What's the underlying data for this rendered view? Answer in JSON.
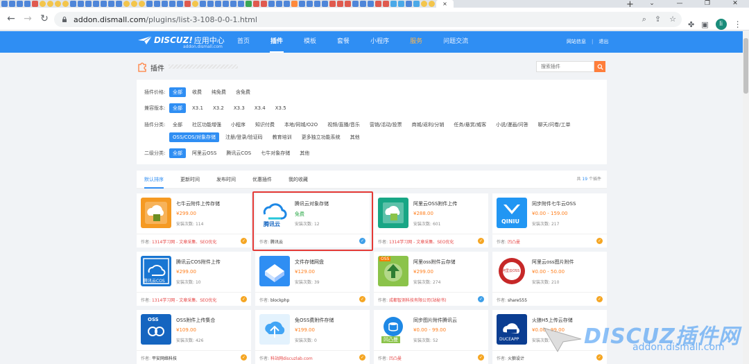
{
  "browser": {
    "url_host": "addon.dismall.com",
    "url_path": "/plugins/list-3-108-0-0-1.html",
    "avatar_letter": "li",
    "new_tab_symbol": "+",
    "close_tab_symbol": "×"
  },
  "header": {
    "brand": "DISCUZ!",
    "brand_cn": "应用中心",
    "sub": "addon.dismall.com",
    "nav": [
      "首页",
      "插件",
      "模板",
      "套餐",
      "小程序",
      "服务",
      "问题交流"
    ],
    "active_nav": "插件",
    "hot_nav": "服务",
    "user_links": [
      "网站信息",
      "退出"
    ]
  },
  "page": {
    "title": "插件",
    "search_placeholder": "搜索插件"
  },
  "filters": {
    "price": {
      "label": "插件价格:",
      "options": [
        "全部",
        "收费",
        "纯免费",
        "含免费"
      ],
      "selected": "全部"
    },
    "version": {
      "label": "兼容版本:",
      "options": [
        "全部",
        "X3.1",
        "X3.2",
        "X3.3",
        "X3.4",
        "X3.5"
      ],
      "selected": "全部"
    },
    "category": {
      "label": "插件分类:",
      "options_row1": [
        "全部",
        "社区功能增强",
        "小程序",
        "知识付费",
        "本地/同城/O2O",
        "视频/直播/音乐",
        "营销/活动/投票",
        "商城/返利/分销",
        "任务/悬赏/威客",
        "小说/漫画/问答",
        "聊天/问卷/工单"
      ],
      "options_row2": [
        "OSS/COS/对象存储",
        "注册/登录/验证码",
        "教育培训",
        "更多独立功能系统",
        "其他"
      ],
      "selected": "OSS/COS/对象存储"
    },
    "sub_category": {
      "label": "二级分类:",
      "options": [
        "全部",
        "阿里云OSS",
        "腾讯云COS",
        "七牛对象存储",
        "其他"
      ],
      "selected": "全部"
    }
  },
  "sort": {
    "tabs": [
      "默认排序",
      "更新时间",
      "发布时间",
      "优惠插件",
      "我的收藏"
    ],
    "selected": "默认排序",
    "total_prefix": "共",
    "total_count": "19",
    "total_suffix": "个插件"
  },
  "cards": [
    {
      "name": "七牛云附件上传存储",
      "price": "¥299.00",
      "installs_label": "安装次数:",
      "installs": "114",
      "author_label": "作者:",
      "author": "1314学习网 - 文章采集、SEO优化",
      "author_red": true,
      "badge": "gold",
      "icon": "qiniu-cloud-icon"
    },
    {
      "name": "腾讯云对象存储",
      "price": "免费",
      "free": true,
      "installs_label": "安装次数:",
      "installs": "12",
      "author_label": "作者:",
      "author": "腾讯云",
      "author_red": false,
      "badge": "blue",
      "icon": "tencent-cloud-logo",
      "logo_text": "腾讯云"
    },
    {
      "name": "阿里云OSS附件上传",
      "price": "¥288.00",
      "installs_label": "安装次数:",
      "installs": "601",
      "author_label": "作者:",
      "author": "1314学习网 - 文章采集、SEO优化",
      "author_red": true,
      "badge": "gold",
      "icon": "aliyun-oss-icon"
    },
    {
      "name": "同步附件七牛云OSS",
      "price": "¥0.00 - 159.00",
      "installs_label": "安装次数:",
      "installs": "217",
      "author_label": "作者:",
      "author": "凹凸曼",
      "author_red": true,
      "badge": "gold",
      "icon": "qiniu-sync-icon",
      "logo_text": "QINIU"
    },
    {
      "name": "腾讯云COS附件上传",
      "price": "¥299.00",
      "installs_label": "安装次数:",
      "installs": "10",
      "author_label": "作者:",
      "author": "1314学习网 - 文章采集、SEO优化",
      "author_red": true,
      "badge": "gold",
      "icon": "tencent-cos-icon",
      "logo_text": "腾讯云COS"
    },
    {
      "name": "文件存储网盘",
      "price": "¥129.00",
      "installs_label": "安装次数:",
      "installs": "39",
      "author_label": "作者:",
      "author": "blockphp",
      "author_red": false,
      "badge": "gold",
      "icon": "netdisk-icon"
    },
    {
      "name": "阿里oss附件云存储",
      "price": "¥299.00",
      "installs_label": "安装次数:",
      "installs": "274",
      "author_label": "作者:",
      "author": "成都智测科技有限公司(站秘书)",
      "author_red": true,
      "badge": "blue",
      "icon": "oss-upload-icon",
      "logo_text": "OSS"
    },
    {
      "name": "阿里云oss图片附件",
      "price": "¥0.00 - 50.00",
      "installs_label": "安装次数:",
      "installs": "210",
      "author_label": "作者:",
      "author": "share555",
      "author_red": false,
      "badge": "gold",
      "icon": "aliyun-image-icon",
      "logo_text": "阿里云OSS"
    },
    {
      "name": "OSS附件上传集合",
      "price": "¥109.00",
      "installs_label": "安装次数:",
      "installs": "426",
      "author_label": "作者:",
      "author": "平安网络科技",
      "author_red": false,
      "badge": "gold",
      "icon": "oss-collection-icon",
      "logo_text": "OSS"
    },
    {
      "name": "免OSS费附件存储",
      "price": "¥199.00",
      "installs_label": "安装次数:",
      "installs": "0",
      "author_label": "作者:",
      "author": "科站网discuzlab.com",
      "author_red": true,
      "badge": "gold",
      "icon": "free-oss-icon"
    },
    {
      "name": "同步图片附件腾讯云",
      "price": "¥0.00 - 99.00",
      "installs_label": "安装次数:",
      "installs": "52",
      "author_label": "作者:",
      "author": "凹凸曼",
      "author_red": true,
      "badge": "gold",
      "icon": "tencent-sync-icon",
      "logo_text": "凹凸曼"
    },
    {
      "name": "火狼H5上传云存储",
      "price": "¥0.00 - 99.00",
      "installs_label": "安装次数:",
      "installs": "",
      "author_label": "作者:",
      "author": "火狼设计",
      "author_red": false,
      "badge": "gold",
      "icon": "ducexpp-icon",
      "logo_text": "DUCEAPP"
    }
  ],
  "watermark": {
    "text": "DISCUZ插件网",
    "url": "addon.dismall.com"
  },
  "colors": {
    "brand_blue": "#2f8ef3",
    "price_orange": "#ff7e1b",
    "highlight_red": "#e53935",
    "free_green": "#28a745"
  }
}
